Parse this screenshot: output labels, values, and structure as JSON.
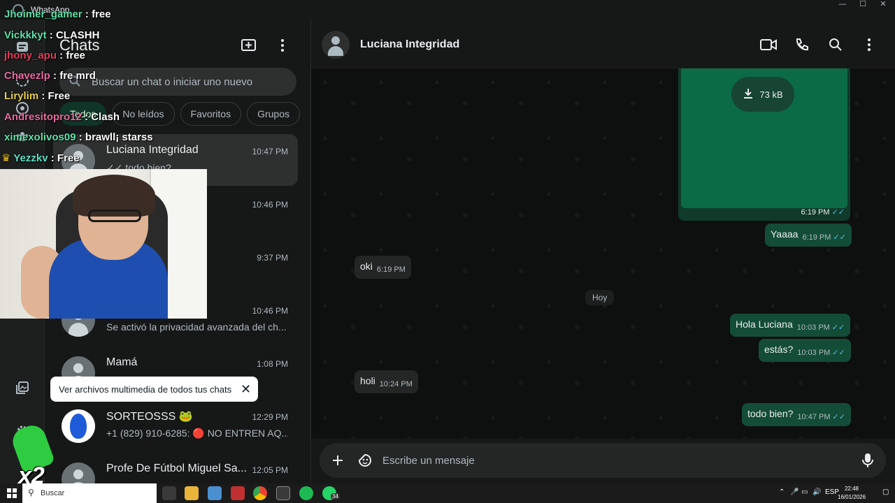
{
  "window": {
    "title": "WhatsApp",
    "controls": [
      "—",
      "☐",
      "✕"
    ]
  },
  "rail": {
    "icons": [
      "chats-icon",
      "status-icon",
      "channels-icon",
      "communities-icon",
      "media-icon",
      "settings-icon"
    ]
  },
  "sidebar": {
    "title": "Chats",
    "search_placeholder": "Buscar un chat o iniciar uno nuevo",
    "filters": [
      "Todos",
      "No leídos",
      "Favoritos",
      "Grupos"
    ],
    "chats": [
      {
        "name": "Luciana Integridad",
        "time": "10:47 PM",
        "preview": "✓✓ todo bien?"
      },
      {
        "name": "",
        "time": "10:46 PM",
        "preview": ""
      },
      {
        "name": "",
        "time": "9:37 PM",
        "preview": ""
      },
      {
        "name": "",
        "time": "10:46 PM",
        "preview": "Se activó la privacidad avanzada del ch..."
      },
      {
        "name": "Mamá",
        "time": "1:08 PM",
        "preview": ""
      },
      {
        "name": "SORTEOSSS 🐸",
        "time": "12:29 PM",
        "preview": "+1 (829) 910-6285: 🔴 NO ENTREN AQ..."
      },
      {
        "name": "Profe De Fútbol Miguel Sa...",
        "time": "12:05 PM",
        "preview": ""
      }
    ],
    "tooltip": "Ver archivos multimedia de todos tus chats"
  },
  "conversation": {
    "contact": "Luciana Integridad",
    "media": {
      "size": "73 kB",
      "time": "6:19 PM"
    },
    "messages": [
      {
        "dir": "out",
        "text": "Yaaaa",
        "time": "6:19 PM"
      },
      {
        "dir": "in",
        "text": "oki",
        "time": "6:19 PM"
      },
      {
        "dir": "out",
        "text": "Hola Luciana",
        "time": "10:03 PM"
      },
      {
        "dir": "out",
        "text": "estás?",
        "time": "10:03 PM"
      },
      {
        "dir": "in",
        "text": "holi",
        "time": "10:24 PM"
      },
      {
        "dir": "out",
        "text": "todo bien?",
        "time": "10:47 PM"
      }
    ],
    "day_label": "Hoy",
    "composer_placeholder": "Escribe un mensaje"
  },
  "stream_chat": [
    {
      "user": "Jhoimer_gamer",
      "msg": "free",
      "color": "#5de0a8"
    },
    {
      "user": "Vickkkyt",
      "msg": "CLASHH",
      "color": "#5de0a8"
    },
    {
      "user": "jhony_apu",
      "msg": "free",
      "color": "#e0405a"
    },
    {
      "user": "Chavezlp",
      "msg": "fre mrd",
      "color": "#e86aa0"
    },
    {
      "user": "Lirylim",
      "msg": "Free",
      "color": "#e8d04a"
    },
    {
      "user": "Andresitopro12",
      "msg": "Clash",
      "color": "#e86aa0"
    },
    {
      "user": "ximexolivos09",
      "msg": "brawll¡ starss",
      "color": "#5de0a8"
    },
    {
      "user": "Yezzkv",
      "msg": "Free",
      "color": "#5de0c8"
    }
  ],
  "badge": {
    "label": "x2"
  },
  "taskbar": {
    "search": "Buscar",
    "lang": "ESP",
    "time": "22:48",
    "date": "16/01/2026",
    "whatsapp_badge": "34"
  }
}
